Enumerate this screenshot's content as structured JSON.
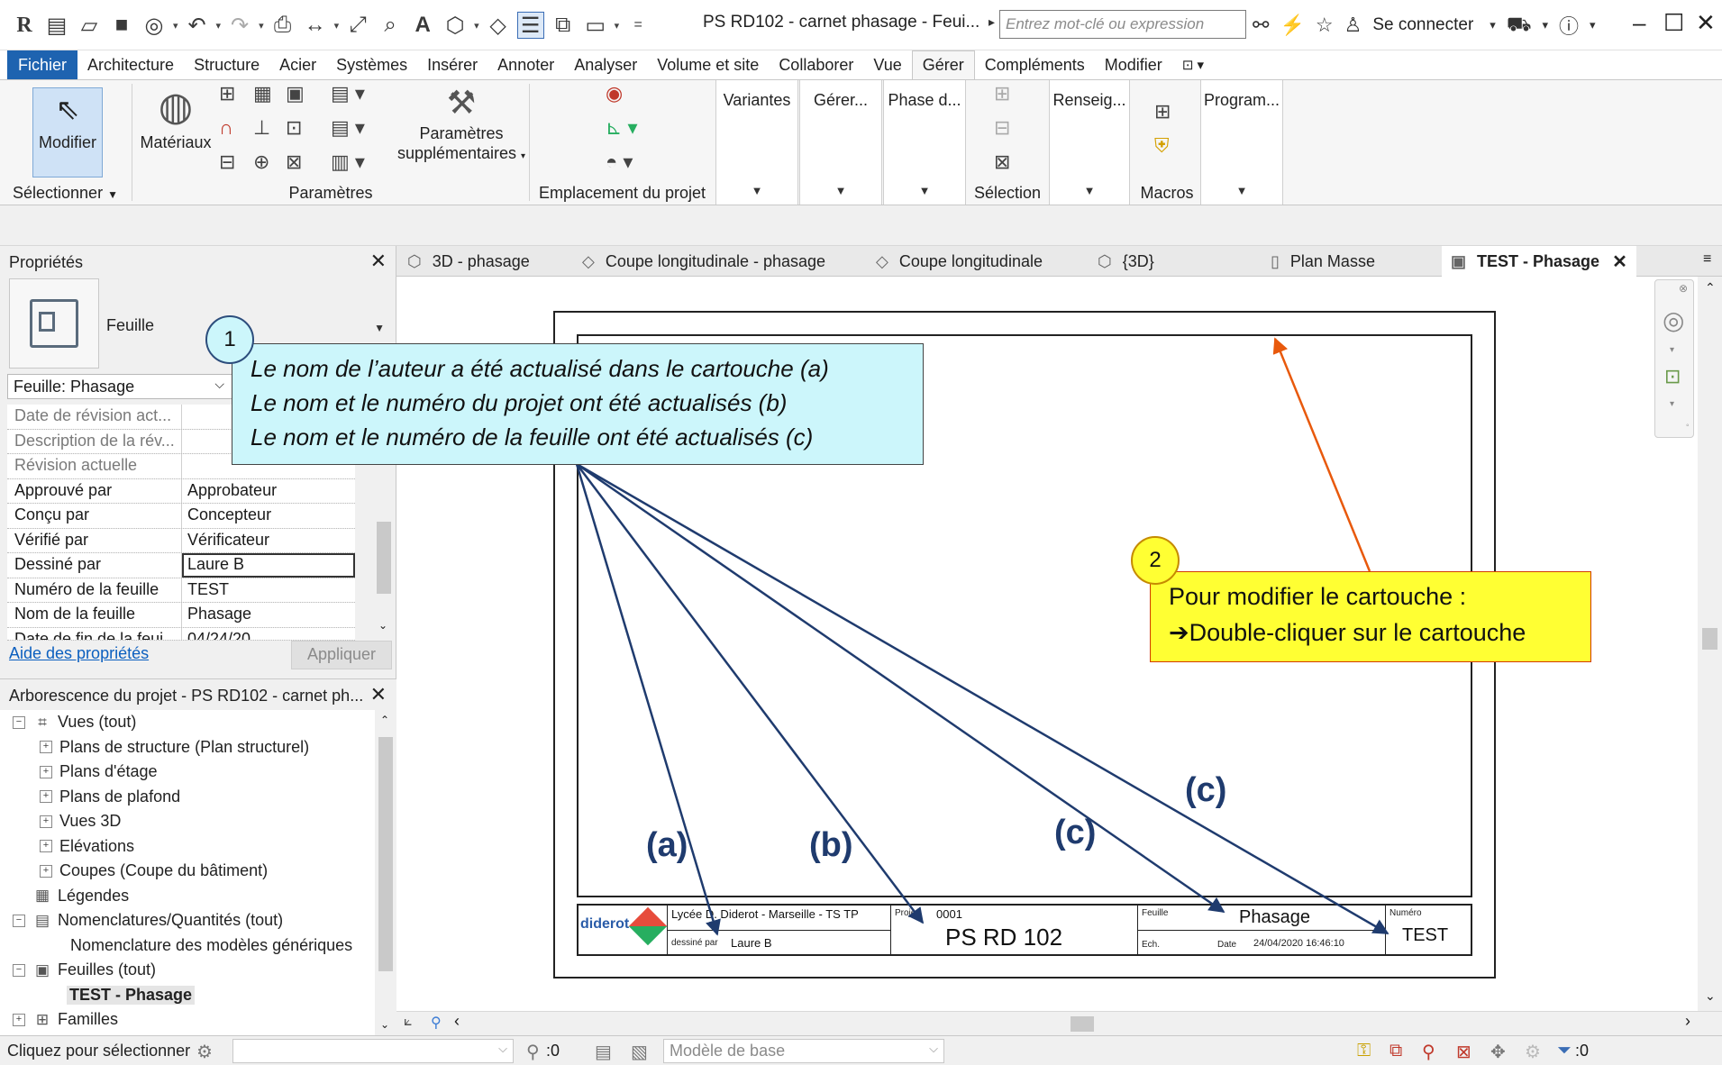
{
  "app": {
    "title": "PS RD102 - carnet phasage - Feui...",
    "search_placeholder": "Entrez mot-clé ou expression",
    "sign_in": "Se connecter"
  },
  "ribbon_tabs": [
    "Fichier",
    "Architecture",
    "Structure",
    "Acier",
    "Systèmes",
    "Insérer",
    "Annoter",
    "Analyser",
    "Volume et site",
    "Collaborer",
    "Vue",
    "Gérer",
    "Compléments",
    "Modifier"
  ],
  "active_tab": "Gérer",
  "ribbon": {
    "modify": "Modifier",
    "select": "Sélectionner",
    "materials": "Matériaux",
    "additional_settings_1": "Paramètres",
    "additional_settings_2": "supplémentaires",
    "settings": "Paramètres",
    "project_location": "Emplacement du projet",
    "variants": "Variantes",
    "manage": "Gérer...",
    "phases": "Phase d...",
    "selection": "Sélection",
    "inquiry": "Renseig...",
    "macros": "Macros",
    "program": "Program..."
  },
  "properties": {
    "title": "Propriétés",
    "type_name": "Feuille",
    "filter": "Feuille: Phasage",
    "rows": [
      {
        "key": "Date de révision act...",
        "value": ""
      },
      {
        "key": "Description de la rév...",
        "value": ""
      },
      {
        "key": "Révision actuelle",
        "value": ""
      },
      {
        "key": "Approuvé par",
        "value": "Approbateur"
      },
      {
        "key": "Conçu par",
        "value": "Concepteur"
      },
      {
        "key": "Vérifié par",
        "value": "Vérificateur"
      },
      {
        "key": "Dessiné par",
        "value": "Laure B"
      },
      {
        "key": "Numéro de la feuille",
        "value": "TEST"
      },
      {
        "key": "Nom de la feuille",
        "value": "Phasage"
      },
      {
        "key": "Date de fin de la feui...",
        "value": "04/24/20..."
      }
    ],
    "help_link": "Aide des propriétés",
    "apply": "Appliquer"
  },
  "browser": {
    "title": "Arborescence du projet - PS RD102 - carnet ph...",
    "items": [
      {
        "label": "Vues (tout)"
      },
      {
        "label": "Plans de structure (Plan structurel)"
      },
      {
        "label": "Plans d'étage"
      },
      {
        "label": "Plans de plafond"
      },
      {
        "label": "Vues 3D"
      },
      {
        "label": "Elévations"
      },
      {
        "label": "Coupes (Coupe du bâtiment)"
      },
      {
        "label": "Légendes"
      },
      {
        "label": "Nomenclatures/Quantités (tout)"
      },
      {
        "label": "Nomenclature des modèles génériques"
      },
      {
        "label": "Feuilles (tout)"
      },
      {
        "label": "TEST - Phasage"
      },
      {
        "label": "Familles"
      }
    ]
  },
  "view_tabs": [
    "3D - phasage",
    "Coupe longitudinale - phasage",
    "Coupe longitudinale",
    "{3D}",
    "Plan Masse",
    "TEST - Phasage"
  ],
  "titleblock": {
    "logo": "diderot",
    "school": "Lycée D. Diderot - Marseille - TS TP",
    "drawn_by_label": "dessiné par",
    "drawn_by": "Laure B",
    "project_label": "Projet",
    "project_number": "0001",
    "project_name": "PS RD 102",
    "sheet_label": "Feuille",
    "sheet_name": "Phasage",
    "scale_label": "Ech.",
    "date_label": "Date",
    "date": "24/04/2020 16:46:10",
    "number_label": "Numéro",
    "number": "TEST"
  },
  "callout1": {
    "badge": "1",
    "line1": "Le nom de l’auteur a été actualisé dans le cartouche (a)",
    "line2": "Le nom et le numéro du projet ont été actualisés (b)",
    "line3": "Le nom et le numéro de la feuille ont été actualisés (c)"
  },
  "callout2": {
    "badge": "2",
    "line1": "Pour modifier le cartouche :",
    "line2": "Double-cliquer sur le cartouche"
  },
  "arrow_labels": {
    "a": "(a)",
    "b": "(b)",
    "c1": "(c)",
    "c2": "(c)"
  },
  "status": {
    "text": "Cliquez pour sélectionner",
    "zero": ":0",
    "model": "Modèle de base",
    "filter_count": ":0"
  },
  "colors": {
    "accent": "#1e63b0",
    "callout1_bg": "#ccf6fb",
    "callout2_bg": "#ffff33",
    "arrow_blue": "#1f3b6e",
    "arrow_orange": "#e8590c"
  }
}
